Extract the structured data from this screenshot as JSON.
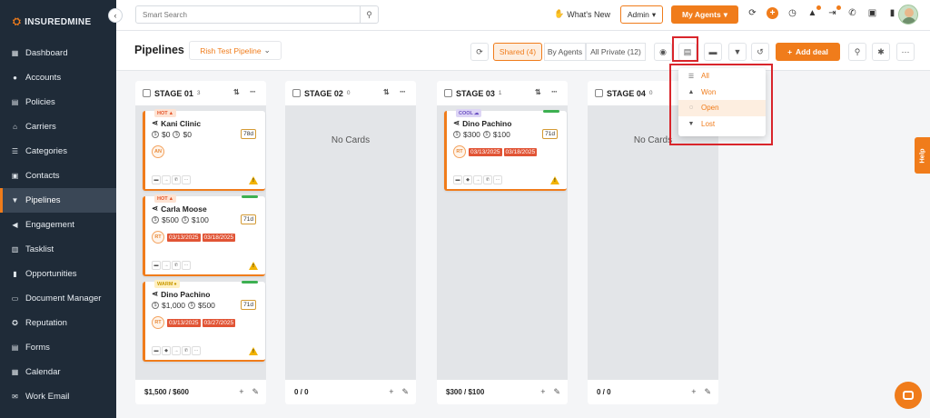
{
  "brand": {
    "name": "INSUREDMINE",
    "accent": "#f07c1b",
    "sidebar_bg": "#1f2b38"
  },
  "sidebar": {
    "items": [
      {
        "label": "Dashboard",
        "icon": "grid-icon"
      },
      {
        "label": "Accounts",
        "icon": "user-icon"
      },
      {
        "label": "Policies",
        "icon": "document-icon"
      },
      {
        "label": "Carriers",
        "icon": "bank-icon"
      },
      {
        "label": "Categories",
        "icon": "list-icon"
      },
      {
        "label": "Contacts",
        "icon": "contact-icon"
      },
      {
        "label": "Pipelines",
        "icon": "filter-icon",
        "active": true
      },
      {
        "label": "Engagement",
        "icon": "megaphone-icon"
      },
      {
        "label": "Tasklist",
        "icon": "tasklist-icon"
      },
      {
        "label": "Opportunities",
        "icon": "bar-chart-icon"
      },
      {
        "label": "Document Manager",
        "icon": "folder-icon"
      },
      {
        "label": "Reputation",
        "icon": "reputation-icon"
      },
      {
        "label": "Forms",
        "icon": "form-icon"
      },
      {
        "label": "Calendar",
        "icon": "calendar-icon"
      },
      {
        "label": "Work Email",
        "icon": "email-icon"
      }
    ]
  },
  "topbar": {
    "search_placeholder": "Smart Search",
    "whats_new": "What's New",
    "admin_value": "Admin",
    "my_agents": "My Agents"
  },
  "header": {
    "title": "Pipelines",
    "pipeline_selected": "Rish Test Pipeline",
    "segments": {
      "shared": "Shared (4)",
      "by_agents": "By Agents",
      "all_private": "All Private (12)"
    },
    "add_deal": "Add deal"
  },
  "dropdown": {
    "items": [
      {
        "label": "All",
        "icon": "list-icon"
      },
      {
        "label": "Won",
        "icon": "thumbs-up-icon"
      },
      {
        "label": "Open",
        "icon": "spinner-icon",
        "selected": true
      },
      {
        "label": "Lost",
        "icon": "thumbs-down-icon"
      }
    ]
  },
  "columns": [
    {
      "title": "STAGE 01",
      "count": "3",
      "total": "$1,500 / $600",
      "no_cards": ""
    },
    {
      "title": "STAGE 02",
      "count": "0",
      "total": "0 / 0",
      "no_cards": "No Cards"
    },
    {
      "title": "STAGE 03",
      "count": "1",
      "total": "$300 / $100",
      "no_cards": ""
    },
    {
      "title": "STAGE 04",
      "count": "0",
      "total": "0 / 0",
      "no_cards": "No Cards"
    }
  ],
  "cards": [
    {
      "tag": "HOT",
      "name": "Kani Clinic",
      "amount1": "$0",
      "amount2": "$0",
      "days": "78d",
      "initials": "AN",
      "dates": []
    },
    {
      "tag": "HOT",
      "name": "Carla Moose",
      "amount1": "$500",
      "amount2": "$100",
      "days": "71d",
      "initials": "RT",
      "dates": [
        "03/13/2025",
        "03/18/2025"
      ]
    },
    {
      "tag": "WARM",
      "name": "Dino Pachino",
      "amount1": "$1,000",
      "amount2": "$500",
      "days": "71d",
      "initials": "RT",
      "dates": [
        "03/13/2025",
        "03/27/2025"
      ]
    },
    {
      "tag": "COOL",
      "name": "Dino Pachino",
      "amount1": "$300",
      "amount2": "$100",
      "days": "71d",
      "initials": "RT",
      "dates": [
        "03/13/2025",
        "03/18/2025"
      ]
    }
  ],
  "help_tab": "Help"
}
